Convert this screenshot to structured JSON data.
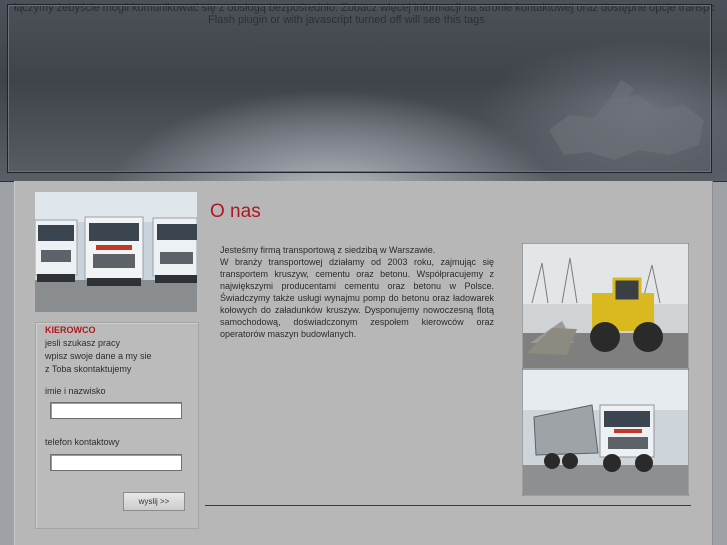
{
  "banner": {
    "background_text": "łączymy żebyście mogli komunikować się z obsługą bezpośrednio. Zobacz więcej informacji na stronie kontaktowej oraz dostępne opcje transportowe",
    "plugin_notice": "Flash plugin or with javascript turned off will see this tags"
  },
  "sidebar": {
    "title": "KIEROWCO",
    "lines": [
      "jesli szukasz pracy",
      "wpisz swoje dane a my sie",
      "z Toba skontaktujemy"
    ],
    "name_label": "imie i nazwisko",
    "name_value": "",
    "phone_label": "telefon kontaktowy",
    "phone_value": "",
    "send_label": "wyslij >>"
  },
  "main": {
    "title": "O nas",
    "paragraph_1": "Jesteśmy firmą transportową z siedzibą w Warszawie.",
    "paragraph_2": "W branży transportowej działamy od 2003 roku, zajmując się transportem kruszyw, cementu oraz betonu. Współpracujemy z największymi producentami cementu oraz betonu w Polsce. Świadczymy także usługi wynajmu pomp do betonu oraz ładowarek kołowych do załadunków kruszyw. Dysponujemy nowoczesną flotą samochodową, doświadczonym zespołem kierowców oraz operatorów maszyn budowlanych."
  },
  "photos": {
    "trucks_icon": "truck-fleet-photo",
    "loader_icon": "wheel-loader-photo",
    "tipper_icon": "tipper-truck-photo"
  },
  "colors": {
    "accent": "#b0171f",
    "panel": "#b7b7b7",
    "page": "#9ea1a6"
  }
}
